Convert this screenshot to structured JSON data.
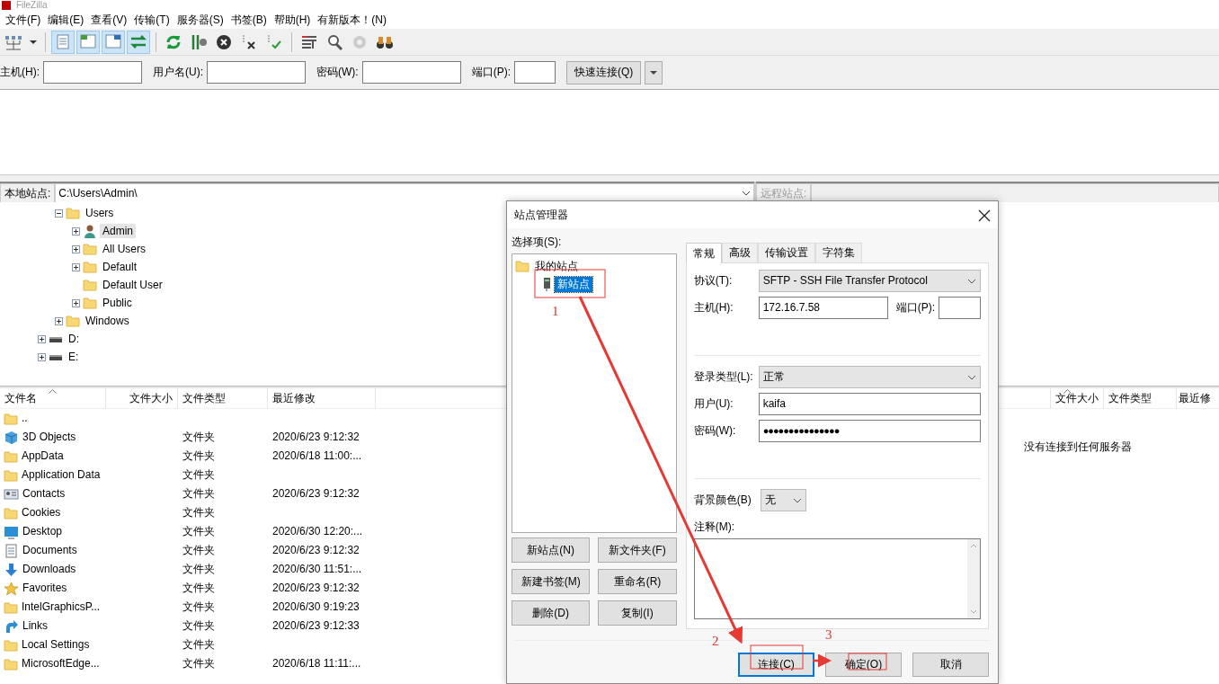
{
  "window": {
    "title": "FileZilla"
  },
  "menu": [
    "文件(F)",
    "编辑(E)",
    "查看(V)",
    "传输(T)",
    "服务器(S)",
    "书签(B)",
    "帮助(H)",
    "有新版本！(N)"
  ],
  "toolbar": [
    {
      "pressed": false,
      "disabled": false
    },
    {
      "pressed": false,
      "disabled": false
    },
    {
      "pressed": true,
      "disabled": false
    },
    {
      "pressed": true,
      "disabled": false
    },
    {
      "pressed": true,
      "disabled": false
    },
    {
      "pressed": true,
      "disabled": false
    },
    {
      "pressed": false,
      "disabled": false
    },
    {
      "pressed": false,
      "disabled": false
    },
    {
      "pressed": false,
      "disabled": false
    },
    {
      "pressed": false,
      "disabled": false
    },
    {
      "pressed": false,
      "disabled": false
    },
    {
      "pressed": false,
      "disabled": false
    },
    {
      "pressed": false,
      "disabled": false
    },
    {
      "pressed": false,
      "disabled": true
    },
    {
      "pressed": false,
      "disabled": false
    }
  ],
  "quickconnect": {
    "fields": [
      {
        "label": "主机(H):"
      },
      {
        "label": "用户名(U):"
      },
      {
        "label": "密码(W):"
      },
      {
        "label": "端口(P):"
      }
    ],
    "button": "快速连接(Q)"
  },
  "local_site": {
    "label": "本地站点:",
    "path": "C:\\Users\\Admin\\"
  },
  "local_tree": [
    {
      "children": [
        {
          "label": "Users",
          "kind": "folder",
          "has_children": true,
          "expanded": true,
          "selected": false,
          "children": [
            {
              "label": "Admin",
              "kind": "user",
              "has_children": true,
              "expanded": false,
              "selected": true
            },
            {
              "label": "All Users",
              "kind": "folder",
              "has_children": true,
              "expanded": false,
              "selected": false
            },
            {
              "label": "Default",
              "kind": "folder",
              "has_children": true,
              "expanded": false,
              "selected": false
            },
            {
              "label": "Default User",
              "kind": "folder",
              "selected": false
            },
            {
              "label": "Public",
              "kind": "folder",
              "has_children": true,
              "expanded": false,
              "selected": false
            }
          ]
        },
        {
          "label": "Windows",
          "kind": "folder",
          "has_children": true,
          "expanded": false,
          "selected": false
        }
      ]
    },
    {
      "label": "D:",
      "kind": "drive",
      "has_children": true,
      "expanded": false,
      "selected": false
    },
    {
      "label": "E:",
      "kind": "drive",
      "has_children": true,
      "expanded": false,
      "selected": false
    }
  ],
  "local_files": {
    "columns": [
      {
        "label": "文件名",
        "sorted": true
      },
      {
        "label": "文件大小",
        "sorted": false
      },
      {
        "label": "文件类型",
        "sorted": false
      },
      {
        "label": "最近修改",
        "sorted": false
      }
    ],
    "rows": [
      {
        "kind": "folder",
        "name": ".."
      },
      {
        "kind": "cube",
        "name": "3D Objects",
        "type": "文件夹",
        "modified": "2020/6/23 9:12:32"
      },
      {
        "kind": "folder",
        "name": "AppData",
        "type": "文件夹",
        "modified": "2020/6/18 11:00:..."
      },
      {
        "kind": "folder",
        "name": "Application Data",
        "type": "文件夹"
      },
      {
        "kind": "contacts",
        "name": "Contacts",
        "type": "文件夹",
        "modified": "2020/6/23 9:12:32"
      },
      {
        "kind": "folder",
        "name": "Cookies",
        "type": "文件夹"
      },
      {
        "kind": "desktop",
        "name": "Desktop",
        "type": "文件夹",
        "modified": "2020/6/30 12:20:..."
      },
      {
        "kind": "documents",
        "name": "Documents",
        "type": "文件夹",
        "modified": "2020/6/23 9:12:32"
      },
      {
        "kind": "downloads",
        "name": "Downloads",
        "type": "文件夹",
        "modified": "2020/6/30 11:51:..."
      },
      {
        "kind": "favorites",
        "name": "Favorites",
        "type": "文件夹",
        "modified": "2020/6/23 9:12:32"
      },
      {
        "kind": "folder",
        "name": "IntelGraphicsP...",
        "type": "文件夹",
        "modified": "2020/6/30 9:19:23"
      },
      {
        "kind": "links",
        "name": "Links",
        "type": "文件夹",
        "modified": "2020/6/23 9:12:33"
      },
      {
        "kind": "folder",
        "name": "Local Settings",
        "type": "文件夹"
      },
      {
        "kind": "folder",
        "name": "MicrosoftEdge...",
        "type": "文件夹",
        "modified": "2020/6/18 11:11:..."
      }
    ]
  },
  "remote_site": {
    "label": "远程站点:",
    "disabled": true
  },
  "remote_files": {
    "columns": [
      {
        "label": "文件大小",
        "sorted": true
      },
      {
        "label": "文件类型",
        "sorted": false
      },
      {
        "label": "最近修",
        "sorted": false
      }
    ],
    "message": "没有连接到任何服务器"
  },
  "site_manager": {
    "title": "站点管理器",
    "select_label": "选择项(S):",
    "tree": [
      {
        "label": "我的站点",
        "kind": "folder",
        "selected": false,
        "children": [
          {
            "label": "新站点",
            "kind": "server",
            "selected": true
          }
        ]
      }
    ],
    "tree_buttons": [
      "新站点(N)",
      "新文件夹(F)",
      "新建书签(M)",
      "重命名(R)",
      "删除(D)",
      "复制(I)"
    ],
    "tabs": [
      {
        "label": "常规",
        "selected": true
      },
      {
        "label": "高级",
        "selected": false
      },
      {
        "label": "传输设置",
        "selected": false
      },
      {
        "label": "字符集",
        "selected": false
      }
    ],
    "protocol": {
      "label": "协议(T):",
      "value": "SFTP - SSH File Transfer Protocol"
    },
    "host": {
      "label": "主机(H):",
      "value": "172.16.7.58"
    },
    "port": {
      "label": "端口(P):"
    },
    "logon_type": {
      "label": "登录类型(L):",
      "value": "正常"
    },
    "user": {
      "label": "用户(U):",
      "value": "kaifa"
    },
    "password": {
      "label": "密码(W):",
      "value": "●●●●●●●●●●●●●●●"
    },
    "background_color": {
      "label": "背景颜色(B)",
      "value": "无"
    },
    "comments": {
      "label": "注释(M):"
    },
    "footer_buttons": [
      {
        "label": "连接(C)",
        "focused": true
      },
      {
        "label": "确定(O)",
        "focused": false
      },
      {
        "label": "取消",
        "focused": false
      }
    ]
  },
  "annotations": [
    {
      "label": "1"
    },
    {
      "label": "2"
    },
    {
      "label": "3"
    }
  ]
}
